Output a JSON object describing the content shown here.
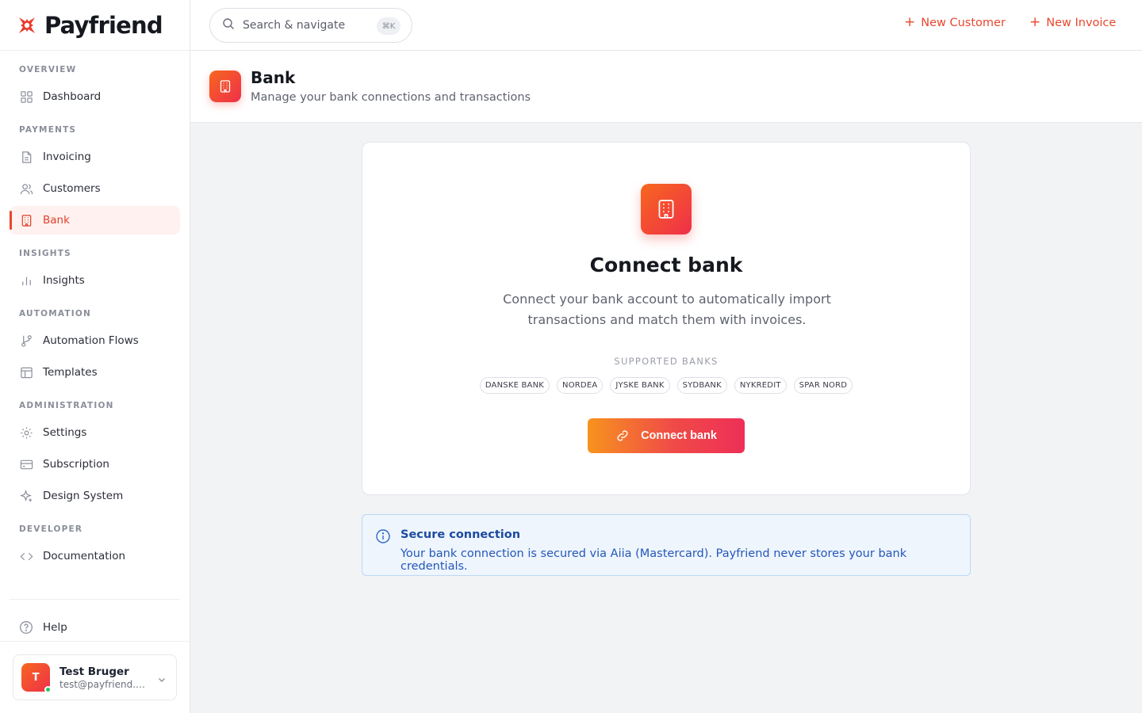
{
  "brand": {
    "name": "Payfriend",
    "logo_icon": "payfriend-logo-icon",
    "accent": "#e8462e"
  },
  "sidebar": {
    "sections": [
      {
        "title": "OVERVIEW",
        "items": [
          {
            "label": "Dashboard",
            "icon": "grid-icon"
          }
        ]
      },
      {
        "title": "PAYMENTS",
        "items": [
          {
            "label": "Invoicing",
            "icon": "file-icon"
          },
          {
            "label": "Customers",
            "icon": "users-icon"
          },
          {
            "label": "Bank",
            "icon": "building-icon",
            "active": true
          }
        ]
      },
      {
        "title": "INSIGHTS",
        "items": [
          {
            "label": "Insights",
            "icon": "bar-chart-icon"
          }
        ]
      },
      {
        "title": "AUTOMATION",
        "items": [
          {
            "label": "Automation Flows",
            "icon": "git-branch-icon"
          },
          {
            "label": "Templates",
            "icon": "layout-icon"
          }
        ]
      },
      {
        "title": "ADMINISTRATION",
        "items": [
          {
            "label": "Settings",
            "icon": "gear-icon"
          },
          {
            "label": "Subscription",
            "icon": "credit-card-icon"
          },
          {
            "label": "Design System",
            "icon": "sparkle-icon"
          }
        ]
      },
      {
        "title": "DEVELOPER",
        "items": [
          {
            "label": "Documentation",
            "icon": "code-icon"
          }
        ]
      }
    ],
    "help_label": "Help",
    "user": {
      "initial": "T",
      "name": "Test Bruger",
      "email": "test@payfriend.t..."
    }
  },
  "topbar": {
    "search_placeholder": "Search & navigate",
    "search_shortcut": "⌘K",
    "new_customer": "New Customer",
    "new_invoice": "New Invoice"
  },
  "page_header": {
    "title": "Bank",
    "subtitle": "Manage your bank connections and transactions"
  },
  "connect_card": {
    "title": "Connect bank",
    "description": "Connect your bank account to automatically import transactions and match them with invoices.",
    "supported_label": "SUPPORTED BANKS",
    "banks": [
      "DANSKE BANK",
      "NORDEA",
      "JYSKE BANK",
      "SYDBANK",
      "NYKREDIT",
      "SPAR NORD"
    ],
    "button_label": "Connect bank"
  },
  "info_box": {
    "title": "Secure connection",
    "text": "Your bank connection is secured via Aiia (Mastercard). Payfriend never stores your bank credentials."
  }
}
